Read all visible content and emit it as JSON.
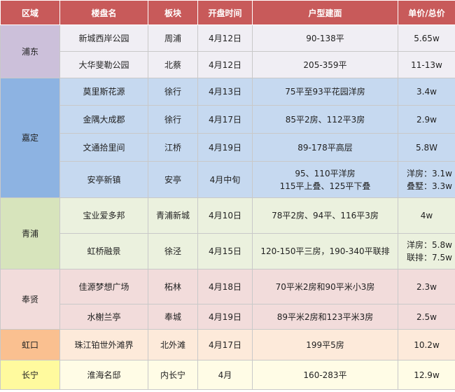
{
  "headers": [
    "区域",
    "楼盘名",
    "板块",
    "开盘时间",
    "户型建面",
    "单价/总价"
  ],
  "regions": [
    {
      "name": "浦东",
      "rows": [
        {
          "name": "新城西岸公园",
          "block": "周浦",
          "date": "4月12日",
          "area": [
            "90-138平"
          ],
          "price": [
            "5.65w"
          ]
        },
        {
          "name": "大华斐勒公园",
          "block": "北蔡",
          "date": "4月12日",
          "area": [
            "205-359平"
          ],
          "price": [
            "11-13w"
          ]
        }
      ]
    },
    {
      "name": "嘉定",
      "rows": [
        {
          "name": "莫里斯花源",
          "block": "徐行",
          "date": "4月13日",
          "area": [
            "75平至93平花园洋房"
          ],
          "price": [
            "3.4w"
          ]
        },
        {
          "name": "金隅大成郡",
          "block": "徐行",
          "date": "4月17日",
          "area": [
            "85平2房、112平3房"
          ],
          "price": [
            "2.9w"
          ]
        },
        {
          "name": "文通拾里间",
          "block": "江桥",
          "date": "4月19日",
          "area": [
            "89-178平高层"
          ],
          "price": [
            "5.8W"
          ]
        },
        {
          "name": "安亭新镇",
          "block": "安亭",
          "date": "4月中旬",
          "area": [
            "95、110平洋房",
            "115平上叠、125平下叠"
          ],
          "price": [
            "洋房：3.1w",
            "叠墅：3.3w"
          ]
        }
      ]
    },
    {
      "name": "青浦",
      "rows": [
        {
          "name": "宝业爱多邦",
          "block": "青浦新城",
          "date": "4月10日",
          "area": [
            "78平2房、94平、116平3房"
          ],
          "price": [
            "4w"
          ]
        },
        {
          "name": "虹桥融景",
          "block": "徐泾",
          "date": "4月15日",
          "area": [
            "120-150平三房，190-340平联排"
          ],
          "price": [
            "洋房：5.8w",
            "联排：7.5w"
          ]
        }
      ]
    },
    {
      "name": "奉贤",
      "rows": [
        {
          "name": "佳源梦想广场",
          "block": "柘林",
          "date": "4月18日",
          "area": [
            "70平米2房和90平米小3房"
          ],
          "price": [
            "2.3w"
          ]
        },
        {
          "name": "水榭兰亭",
          "block": "奉城",
          "date": "4月19日",
          "area": [
            "89平米2房和123平米3房"
          ],
          "price": [
            "2.5w"
          ]
        }
      ]
    },
    {
      "name": "虹口",
      "rows": [
        {
          "name": "珠江铂世外滩界",
          "block": "北外滩",
          "date": "4月17日",
          "area": [
            "199平5房"
          ],
          "price": [
            "10.2w"
          ]
        }
      ]
    },
    {
      "name": "长宁",
      "rows": [
        {
          "name": "淮海名邸",
          "block": "内长宁",
          "date": "4月",
          "area": [
            "160-283平"
          ],
          "price": [
            "12.9w"
          ]
        }
      ]
    }
  ]
}
